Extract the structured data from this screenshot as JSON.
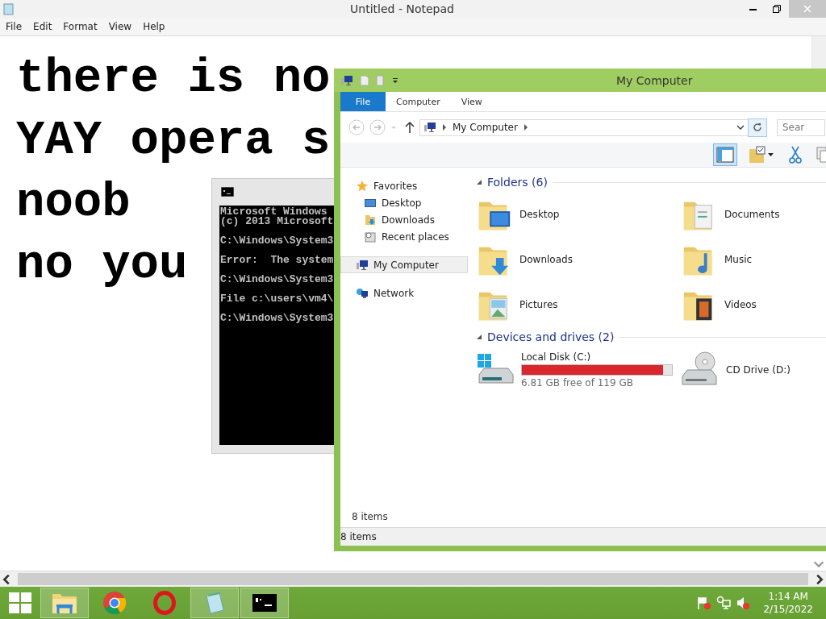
{
  "notepad": {
    "title": "Untitled - Notepad",
    "menu": [
      "File",
      "Edit",
      "Format",
      "View",
      "Help"
    ],
    "lines": [
      "there is no",
      "YAY opera s",
      "noob",
      "no you"
    ]
  },
  "cmd": {
    "blocks": [
      [
        "Microsoft Windows",
        "(c) 2013 Microsoft"
      ],
      [
        "C:\\Windows\\System3"
      ],
      [
        "Error:  The system"
      ],
      [
        "C:\\Windows\\System3"
      ],
      [
        "File c:\\users\\vm4\\"
      ],
      [
        "C:\\Windows\\System3"
      ]
    ]
  },
  "explorer": {
    "title": "My Computer",
    "tabs": [
      {
        "label": "File",
        "kind": "menu",
        "selected": false
      },
      {
        "label": "Computer",
        "kind": "tab",
        "selected": false
      },
      {
        "label": "View",
        "kind": "tab",
        "selected": false
      }
    ],
    "address": "My Computer",
    "search_placeholder": "Sear",
    "toolbar": [
      {
        "kind": "pane",
        "on": true
      },
      {
        "kind": "properties",
        "on": false
      },
      {
        "kind": "cut",
        "on": false
      },
      {
        "kind": "copy",
        "on": false
      }
    ],
    "nav": [
      {
        "label": "Favorites",
        "kind": "favorites",
        "selected": false,
        "children": [
          {
            "label": "Desktop",
            "kind": "desktop",
            "selected": false
          },
          {
            "label": "Downloads",
            "kind": "downloads",
            "selected": false
          },
          {
            "label": "Recent places",
            "kind": "recent",
            "selected": false
          }
        ]
      },
      {
        "label": "My Computer",
        "kind": "computer",
        "selected": true
      },
      {
        "label": "Network",
        "kind": "network",
        "selected": false
      }
    ],
    "folders_title": "Folders (6)",
    "folders": [
      {
        "label": "Desktop",
        "kind": "desktop"
      },
      {
        "label": "Documents",
        "kind": "documents"
      },
      {
        "label": "Downloads",
        "kind": "downloads"
      },
      {
        "label": "Music",
        "kind": "music"
      },
      {
        "label": "Pictures",
        "kind": "pictures"
      },
      {
        "label": "Videos",
        "kind": "videos"
      }
    ],
    "drives_title": "Devices and drives (2)",
    "drives": [
      {
        "label": "Local Disk (C:)",
        "kind": "disk",
        "level": 0.94,
        "free": "6.81 GB free of 119 GB"
      },
      {
        "label": "CD Drive (D:)",
        "kind": "cd"
      }
    ],
    "count": "8 items",
    "status": "8 items"
  },
  "taskbar": {
    "apps": [
      {
        "kind": "explorer",
        "active": true
      },
      {
        "kind": "chrome",
        "active": false
      },
      {
        "kind": "opera",
        "active": false
      },
      {
        "kind": "notepad",
        "active": true
      },
      {
        "kind": "cmd",
        "active": true
      }
    ],
    "time": "1:14 AM",
    "date": "2/15/2022"
  }
}
